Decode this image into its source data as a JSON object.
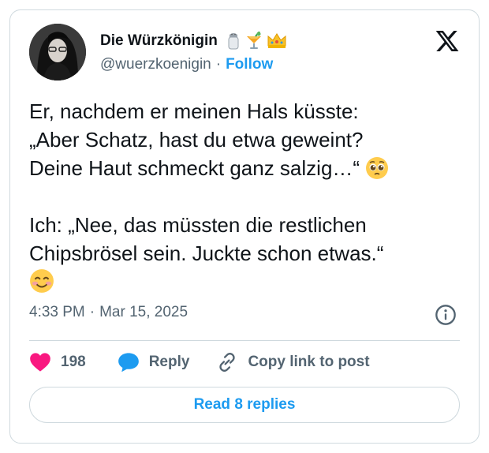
{
  "author": {
    "name": "Die Würzkönigin",
    "name_emojis": [
      "salt-shaker-icon",
      "tropical-drink-icon",
      "crown-icon"
    ],
    "handle": "@wuerzkoenigin",
    "separator": "·",
    "follow_label": "Follow"
  },
  "tweet": {
    "line1": "Er, nachdem er meinen Hals küsste:",
    "line2": "„Aber Schatz, hast du etwa geweint?",
    "line3": "Deine Haut schmeckt ganz salzig…“",
    "line4": "Ich: „Nee, das müssten die restlichen",
    "line5": "Chipsbrösel sein. Juckte schon etwas.“"
  },
  "meta": {
    "time": "4:33 PM",
    "separator": "·",
    "date": "Mar 15, 2025"
  },
  "actions": {
    "like_count": "198",
    "reply_label": "Reply",
    "copy_label": "Copy link to post"
  },
  "read_replies_label": "Read 8 replies",
  "colors": {
    "accent": "#1d9bf0",
    "heart": "#f91880",
    "text": "#0f1419",
    "muted": "#536471",
    "border": "#cfd9de"
  }
}
